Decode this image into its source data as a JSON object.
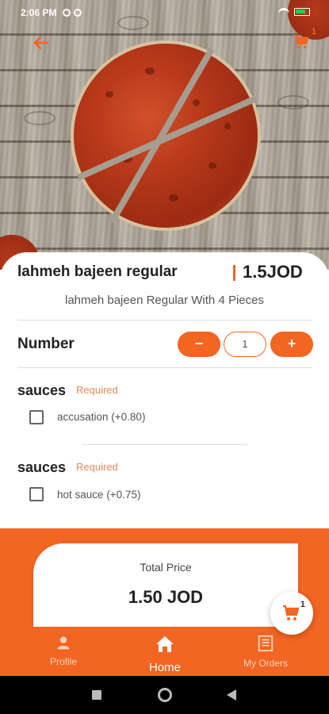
{
  "status_bar": {
    "time": "2:06 PM"
  },
  "header": {
    "back_icon": "arrow-left-icon",
    "cart_count": "1",
    "accent_color": "#f26522"
  },
  "product": {
    "name": "lahmeh bajeen regular",
    "price": "1.5JOD",
    "description": "lahmeh bajeen  Regular With  4 Pieces"
  },
  "quantity": {
    "label": "Number",
    "minus": "−",
    "value": "1",
    "plus": "+"
  },
  "option_groups": [
    {
      "title": "sauces",
      "required_label": "Required",
      "options": [
        {
          "label": "accusation (+0.80)",
          "checked": false
        }
      ]
    },
    {
      "title": "sauces",
      "required_label": "Required",
      "options": [
        {
          "label": "hot sauce (+0.75)",
          "checked": false
        }
      ]
    }
  ],
  "total": {
    "label": "Total Price",
    "value": "1.50 JOD"
  },
  "floating_cart": {
    "count": "1"
  },
  "bottom_nav": {
    "items": [
      {
        "label": "Profile",
        "icon": "person-icon",
        "active": false
      },
      {
        "label": "Home",
        "icon": "home-icon",
        "active": true
      },
      {
        "label": "My Orders",
        "icon": "orders-icon",
        "active": false
      }
    ]
  }
}
